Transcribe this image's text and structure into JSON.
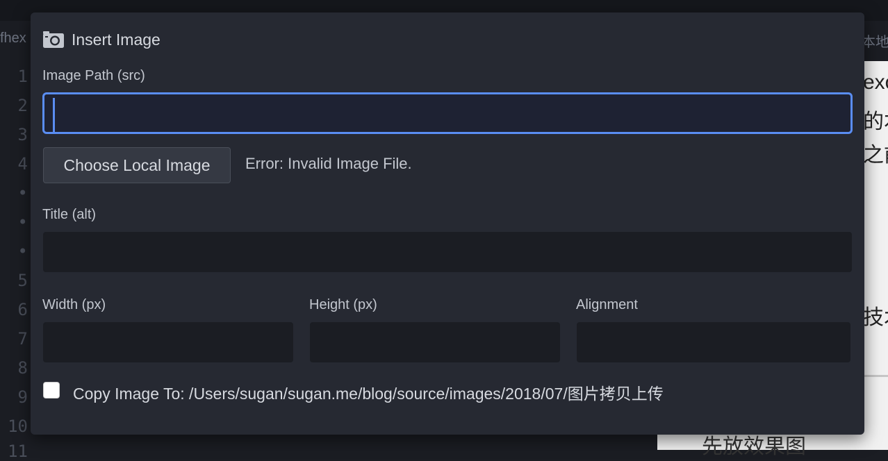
{
  "background": {
    "left_tab_fragment": "fhex",
    "right_tab_fragment": "本地",
    "line_numbers": [
      "1",
      "2",
      "3",
      "4",
      "•",
      "•",
      "•",
      "5",
      "6",
      "7",
      "8",
      "9",
      "10",
      "11"
    ],
    "preview_fragments": [
      "exo",
      "的本",
      "之前",
      "技术"
    ],
    "preview_bottom_text": "先放效果图"
  },
  "modal": {
    "title": "Insert Image",
    "title_icon": "camera-icon",
    "image_path": {
      "label": "Image Path (src)",
      "value": "",
      "focused": true
    },
    "choose_button_label": "Choose Local Image",
    "error_message": "Error: Invalid Image File.",
    "title_field": {
      "label": "Title (alt)",
      "value": ""
    },
    "width_field": {
      "label": "Width (px)",
      "value": ""
    },
    "height_field": {
      "label": "Height (px)",
      "value": ""
    },
    "alignment_field": {
      "label": "Alignment",
      "value": ""
    },
    "copy_image": {
      "checked": false,
      "label": "Copy Image To: /Users/sugan/sugan.me/blog/source/images/2018/07/图片拷贝上传"
    }
  },
  "colors": {
    "modal_bg": "#262932",
    "input_bg": "#1b1d23",
    "focus_accent": "#5a8df2",
    "text": "#d7dae0"
  }
}
